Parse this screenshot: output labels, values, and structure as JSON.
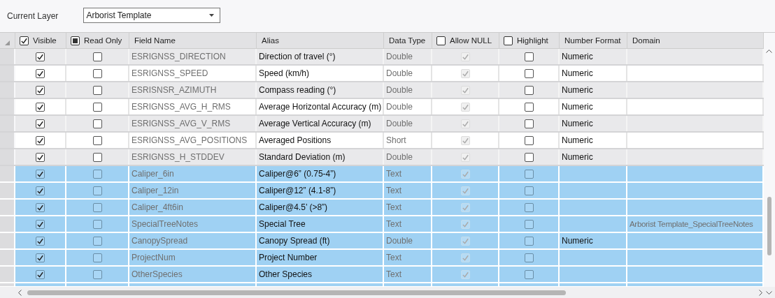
{
  "layer_picker": {
    "label": "Current Layer",
    "value": "Arborist Template"
  },
  "columns": [
    {
      "label": "Visible",
      "kind": "check",
      "checked": true
    },
    {
      "label": "Read Only",
      "kind": "check",
      "checked": false,
      "indeterminate": true
    },
    {
      "label": "Field Name",
      "kind": "text"
    },
    {
      "label": "Alias",
      "kind": "text"
    },
    {
      "label": "Data Type",
      "kind": "text"
    },
    {
      "label": "Allow NULL",
      "kind": "check",
      "checked": false
    },
    {
      "label": "Highlight",
      "kind": "check",
      "checked": false
    },
    {
      "label": "Number Format",
      "kind": "text"
    },
    {
      "label": "Domain",
      "kind": "text"
    }
  ],
  "rows": [
    {
      "selected": false,
      "visible": true,
      "read_only": false,
      "field_name": "ESRIGNSS_DIRECTION",
      "alias": "Direction of travel (°)",
      "data_type": "Double",
      "allow_null": true,
      "highlight": false,
      "number_format": "Numeric"
    },
    {
      "selected": false,
      "visible": true,
      "read_only": false,
      "field_name": "ESRIGNSS_SPEED",
      "alias": "Speed (km/h)",
      "data_type": "Double",
      "allow_null": true,
      "highlight": false,
      "number_format": "Numeric"
    },
    {
      "selected": false,
      "visible": true,
      "read_only": false,
      "field_name": "ESRISNSR_AZIMUTH",
      "alias": "Compass reading (°)",
      "data_type": "Double",
      "allow_null": true,
      "highlight": false,
      "number_format": "Numeric"
    },
    {
      "selected": false,
      "visible": true,
      "read_only": false,
      "field_name": "ESRIGNSS_AVG_H_RMS",
      "alias": "Average Horizontal Accuracy (m)",
      "data_type": "Double",
      "allow_null": true,
      "highlight": false,
      "number_format": "Numeric"
    },
    {
      "selected": false,
      "visible": true,
      "read_only": false,
      "field_name": "ESRIGNSS_AVG_V_RMS",
      "alias": "Average Vertical Accuracy (m)",
      "data_type": "Double",
      "allow_null": true,
      "highlight": false,
      "number_format": "Numeric"
    },
    {
      "selected": false,
      "visible": true,
      "read_only": false,
      "field_name": "ESRIGNSS_AVG_POSITIONS",
      "alias": "Averaged Positions",
      "data_type": "Short",
      "allow_null": true,
      "highlight": false,
      "number_format": "Numeric"
    },
    {
      "selected": false,
      "visible": true,
      "read_only": false,
      "field_name": "ESRIGNSS_H_STDDEV",
      "alias": "Standard Deviation (m)",
      "data_type": "Double",
      "allow_null": true,
      "highlight": false,
      "number_format": "Numeric"
    },
    {
      "selected": true,
      "visible": true,
      "read_only": false,
      "field_name": "Caliper_6in",
      "alias": "Caliper@6” (0.75-4”)",
      "data_type": "Text",
      "allow_null": true,
      "highlight": false
    },
    {
      "selected": true,
      "visible": true,
      "read_only": false,
      "field_name": "Caliper_12in",
      "alias": "Caliper@12” (4.1-8”)",
      "data_type": "Text",
      "allow_null": true,
      "highlight": false
    },
    {
      "selected": true,
      "visible": true,
      "read_only": false,
      "field_name": "Caliper_4ft6in",
      "alias": "Caliper@4.5’ (>8”)",
      "data_type": "Text",
      "allow_null": true,
      "highlight": false
    },
    {
      "selected": true,
      "visible": true,
      "read_only": false,
      "field_name": "SpecialTreeNotes",
      "alias": "Special Tree",
      "data_type": "Text",
      "allow_null": true,
      "highlight": false,
      "domain": "Arborist Template_SpecialTreeNotes"
    },
    {
      "selected": true,
      "visible": true,
      "read_only": false,
      "field_name": "CanopySpread",
      "alias": "Canopy Spread (ft)",
      "data_type": "Double",
      "allow_null": true,
      "highlight": false,
      "number_format": "Numeric"
    },
    {
      "selected": true,
      "visible": true,
      "read_only": false,
      "field_name": "ProjectNum",
      "alias": "Project Number",
      "data_type": "Text",
      "allow_null": true,
      "highlight": false
    },
    {
      "selected": true,
      "visible": true,
      "read_only": false,
      "field_name": "OtherSpecies",
      "alias": "Other Species",
      "data_type": "Text",
      "allow_null": true,
      "highlight": false
    }
  ]
}
